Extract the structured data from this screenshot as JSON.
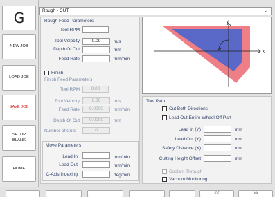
{
  "sidebar": {
    "logo": "G",
    "buttons": [
      {
        "label": "NEW JOB"
      },
      {
        "label": "LOAD JOB"
      },
      {
        "label": "SAVE JOB"
      },
      {
        "label": "SETUP\nBLANK"
      },
      {
        "label": "HOME"
      }
    ]
  },
  "topbar": {
    "selected": "Rough - CUT",
    "caret": "⌄"
  },
  "rough": {
    "title": "Rough Feed Parameters",
    "tool_rpm_label": "Tool RPM",
    "tool_rpm_value": "",
    "tool_velocity_label": "Tool Velocity",
    "tool_velocity_value": "0.00",
    "tool_velocity_unit": "m/s",
    "depth_label": "Depth Of Cut",
    "depth_value": "",
    "depth_unit": "mm",
    "feed_label": "Feed Rate",
    "feed_value": "",
    "feed_unit": "mm/min"
  },
  "finish": {
    "checkbox_label": "Finish",
    "title": "Finish Feed Parameters",
    "tool_rpm_label": "Tool RPM",
    "tool_rpm_value": "0.00",
    "tool_velocity_label": "Tool Velocity",
    "tool_velocity_value": "0.00",
    "tool_velocity_unit": "m/s",
    "feed_label": "Feed Rate",
    "feed_value": "0.0000",
    "feed_unit": "mm/min",
    "depth_label": "Depth Of Cut",
    "depth_value": "0.0000",
    "depth_unit": "mm",
    "cuts_label": "Number of Cuts",
    "cuts_value": "0"
  },
  "move": {
    "title": "Move Parameters",
    "lead_in_label": "Lead In",
    "lead_in_value": "",
    "lead_in_unit": "mm/min",
    "lead_out_label": "Lead Out",
    "lead_out_value": "",
    "lead_out_unit": "mm/min",
    "caxis_label": "C-Axis Indexing",
    "caxis_value": "",
    "caxis_unit": "deg/min"
  },
  "toolpath": {
    "title": "Tool Path",
    "cut_both_label": "Cut Both Directions",
    "lead_out_entire_label": "Lead Out Entire Wheel Off Part",
    "lead_in_y_label": "Lead In (Y)",
    "lead_in_y_unit": "mm",
    "lead_out_y_label": "Lead Out (Y)",
    "lead_out_y_unit": "mm",
    "safety_label": "Safety Distance (X)",
    "safety_unit": "mm",
    "cut_height_label": "Cutting Height Offset",
    "cut_height_unit": "mm",
    "coolant_label": "Coolant Through",
    "vacuum_label": "Vacuum Monitoring"
  },
  "diagram": {
    "y_label": "y",
    "x_label": "x",
    "outer_color": "#ef7f86",
    "inner_color": "#5a68c8"
  },
  "bottom_buttons": [
    {
      "label": ""
    },
    {
      "label": ""
    },
    {
      "label": ""
    },
    {
      "label": ""
    },
    {
      "label": ""
    },
    {
      "label": "<<"
    },
    {
      "label": ">>"
    }
  ]
}
